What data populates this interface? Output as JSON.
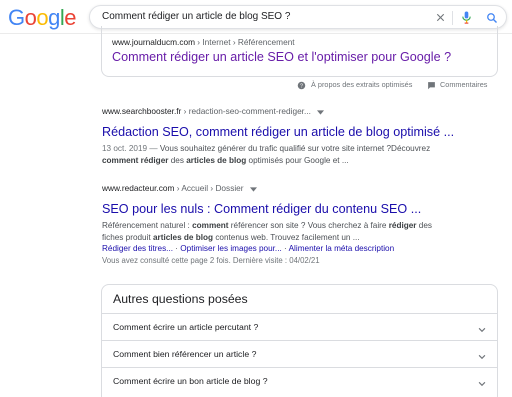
{
  "search": {
    "query": "Comment rédiger un article de blog SEO ?",
    "logo_letters": [
      "G",
      "o",
      "o",
      "g",
      "l",
      "e"
    ]
  },
  "colors": {
    "google_blue": "#4285F4",
    "google_red": "#EA4335",
    "google_yellow": "#FBBC05",
    "google_green": "#34A853",
    "link": "#1a0dab",
    "visited": "#681da8"
  },
  "top_result": {
    "site": "www.journalducm.com",
    "crumbs": " › Internet › Référencement",
    "title": "Comment rédiger un article SEO et l'optimiser pour Google ?"
  },
  "snippet_actions": {
    "about": "À propos des extraits optimisés",
    "feedback": "Commentaires"
  },
  "results": [
    {
      "site": "www.searchbooster.fr",
      "crumbs": " › redaction-seo-comment-rediger...",
      "title": "Rédaction SEO, comment rédiger un article de blog optimisé ...",
      "date": "13 oct. 2019",
      "sep": " — ",
      "snip1": "Vous souhaitez générer du trafic qualifié sur votre site internet ?Découvrez",
      "b1": "comment rédiger",
      "t1": " des ",
      "b2": "articles de blog",
      "t2": " optimisés pour Google et ..."
    },
    {
      "site": "www.redacteur.com",
      "crumbs": " › Accueil › Dossier",
      "title": "SEO pour les nuls : Comment rédiger du contenu SEO ...",
      "l1a": "Référencement naturel : ",
      "l1b": "comment",
      "l1c": " référencer son site ? Vous cherchez à faire ",
      "l1d": "rédiger",
      "l1e": " des",
      "l2a": "fiches produit ",
      "l2b": "articles de blog",
      "l2c": " contenus web. Trouvez facilement un ...",
      "sitelinks": [
        "Rédiger des titres...",
        "Optimiser les images pour...",
        "Alimenter la méta description"
      ],
      "visit": "Vous avez consulté cette page 2 fois. Dernière visite : 04/02/21"
    }
  ],
  "paa": {
    "title": "Autres questions posées",
    "questions": [
      "Comment écrire un article percutant ?",
      "Comment bien référencer un article ?",
      "Comment écrire un bon article de blog ?"
    ]
  }
}
